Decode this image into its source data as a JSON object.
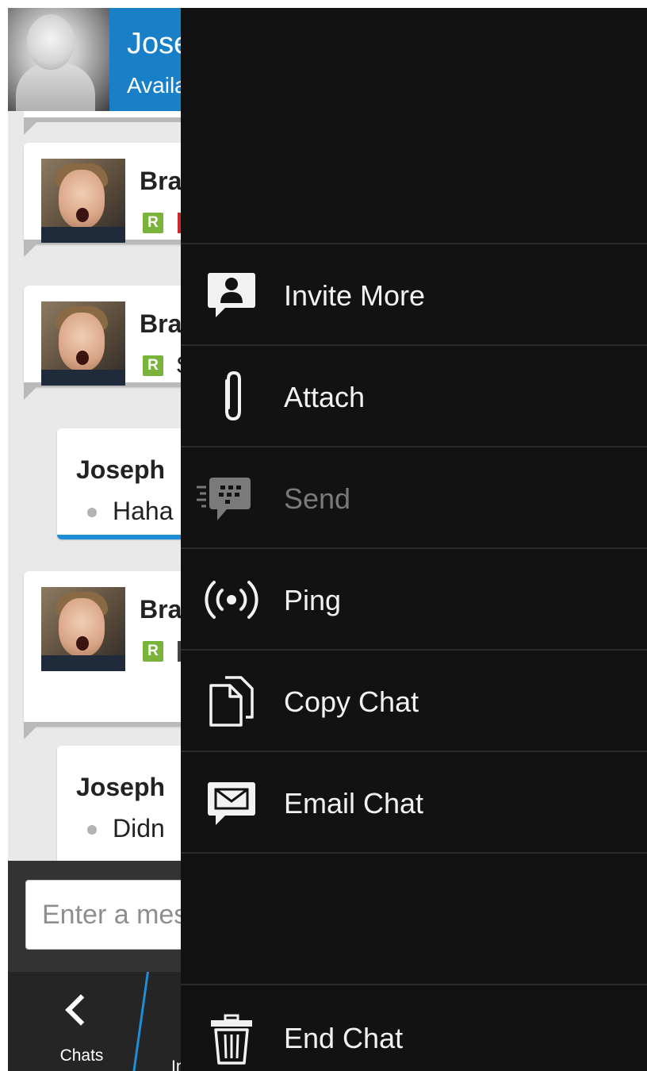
{
  "header": {
    "name": "Joseph",
    "status": "Available"
  },
  "messages": [
    {
      "type": "received",
      "sender": "Bra",
      "badge": "R"
    },
    {
      "type": "received",
      "sender": "Bra",
      "badge": "R",
      "text_fragment": "S"
    },
    {
      "type": "sent",
      "sender": "Joseph",
      "text": "Haha"
    },
    {
      "type": "received",
      "sender": "Bra",
      "badge": "R"
    },
    {
      "type": "sent",
      "sender": "Joseph",
      "text": "Didn"
    }
  ],
  "compose": {
    "placeholder": "Enter a message"
  },
  "action_bar": {
    "back_label": "Chats",
    "next_label": "In"
  },
  "menu": {
    "items": [
      {
        "label": "Invite More",
        "icon": "invite-contact-icon",
        "enabled": true
      },
      {
        "label": "Attach",
        "icon": "paperclip-icon",
        "enabled": true
      },
      {
        "label": "Send",
        "icon": "bbm-send-icon",
        "enabled": false
      },
      {
        "label": "Ping",
        "icon": "ping-icon",
        "enabled": true
      },
      {
        "label": "Copy Chat",
        "icon": "copy-icon",
        "enabled": true
      },
      {
        "label": "Email Chat",
        "icon": "email-icon",
        "enabled": true
      }
    ],
    "end_item": {
      "label": "End Chat",
      "icon": "trash-icon"
    }
  },
  "colors": {
    "header_blue": "#1980c8",
    "menu_background": "#121212",
    "badge_green": "#7ab33a",
    "unread_accent": "#1e8fd6"
  }
}
